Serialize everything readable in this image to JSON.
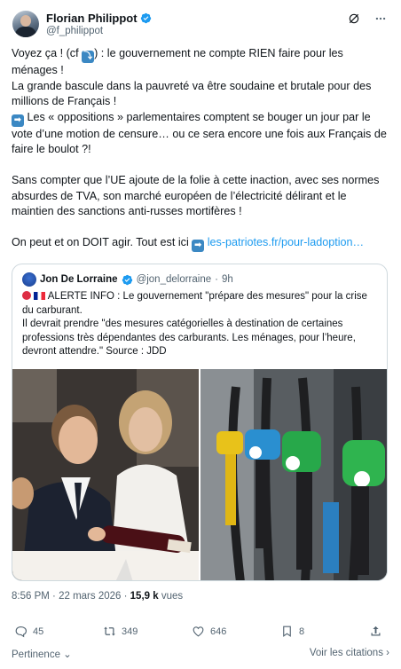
{
  "author": {
    "display_name": "Florian Philippot",
    "handle": "@f_philippot",
    "avatar_icon": "profile-photo"
  },
  "tweet": {
    "lines": [
      "Voyez ça ! (cf",
      ") : le gouvernement ne compte RIEN faire pour les ménages !",
      "La grande bascule dans la pauvreté va être soudaine et brutale pour des millions de Français !",
      "Les « oppositions » parlementaires comptent se bouger un jour par le vote d’une motion de censure… ou ce sera encore une fois aux Français de faire le boulot ?!",
      "Sans compter que l’UE ajoute de la folie à cette inaction, avec ses normes absurdes de TVA, son marché européen de l’électricité délirant et le maintien des sanctions anti-russes mortifères !",
      "On peut et on DOIT agir. Tout est ici",
      "les-patriotes.fr/pour-ladoption…"
    ]
  },
  "quoted": {
    "display_name": "Jon De Lorraine",
    "handle": "@jon_delorraine",
    "separator": "·",
    "time": "9h",
    "text_1": "ALERTE INFO : Le gouvernement \"prépare des mesures\" pour la crise du carburant.",
    "text_2": "Il devrait prendre \"des mesures catégorielles à destination de certaines professions très dépendantes des carburants. Les ménages, pour l’heure, devront attendre.\" Source : JDD",
    "media": [
      "photo-couple-wine",
      "photo-fuel-pumps"
    ]
  },
  "meta": {
    "time": "8:56 PM",
    "dot": "·",
    "date": "22 mars 2026",
    "views_count": "15,9 k",
    "views_label": "vues"
  },
  "actions": {
    "replies": "45",
    "reposts": "349",
    "likes": "646",
    "bookmarks": "8"
  },
  "footer": {
    "relevance": "Pertinence",
    "quotes": "Voir les citations"
  },
  "colors": {
    "text": "#0f1419",
    "secondary": "#536471",
    "link": "#1d9bf0",
    "border": "#cfd9de",
    "verified": "#1d9bf0"
  }
}
